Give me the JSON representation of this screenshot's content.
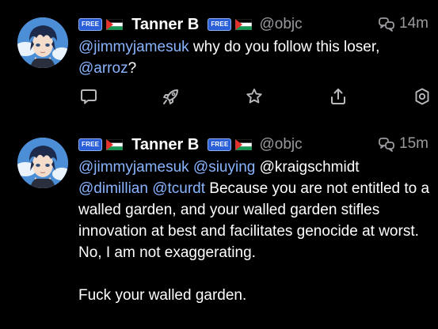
{
  "posts": [
    {
      "author": {
        "name": "Tanner B",
        "handle": "@objc",
        "badge_label": "FREE",
        "badge_color": "#2b5fd8",
        "flag": "palestine-flag",
        "avatar": "anime-character-avatar"
      },
      "thread_icon": "thread-icon",
      "timestamp": "14m",
      "body": {
        "mention_1": "@jimmyjamesuk",
        "text_1": " why do you follow this loser,",
        "mention_2": "@arroz",
        "text_2": "?"
      },
      "actions": [
        {
          "name": "reply",
          "icon": "reply-icon"
        },
        {
          "name": "boost",
          "icon": "rocket-icon"
        },
        {
          "name": "favorite",
          "icon": "star-icon"
        },
        {
          "name": "share",
          "icon": "share-icon"
        },
        {
          "name": "more",
          "icon": "more-icon"
        }
      ]
    },
    {
      "author": {
        "name": "Tanner B",
        "handle": "@objc",
        "badge_label": "FREE",
        "badge_color": "#2b5fd8",
        "flag": "palestine-flag",
        "avatar": "anime-character-avatar"
      },
      "thread_icon": "thread-icon",
      "timestamp": "15m",
      "body": {
        "mention_1": "@jimmyjamesuk",
        "mention_2": "@siuying",
        "plain_mention": "@kraigschmidt",
        "mention_3": "@dimillian",
        "mention_4": "@tcurdt",
        "text_1": "Because you are not entitled to a walled garden, and your walled garden stifles innovation at best and facilitates genocide at worst. No, I am not exaggerating.",
        "text_2": "Fuck your walled garden."
      }
    }
  ],
  "colors": {
    "background": "#000000",
    "text": "#ffffff",
    "secondary": "#9a9a9f",
    "mention": "#8ab4ff",
    "icon": "#b8b8bd"
  }
}
